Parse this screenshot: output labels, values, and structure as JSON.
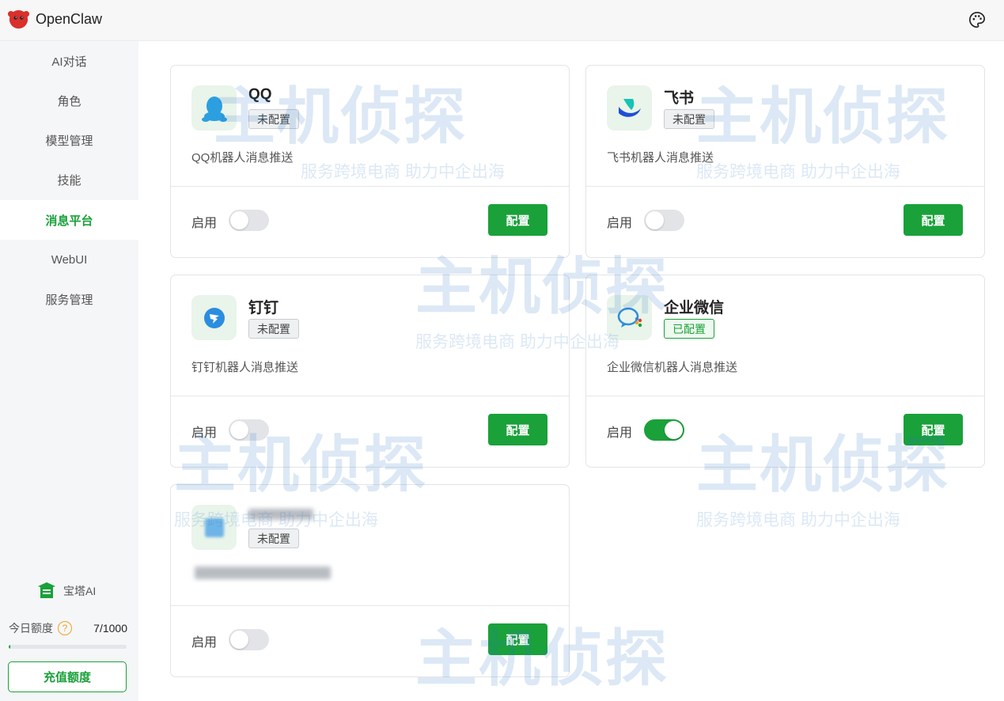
{
  "app": {
    "title": "OpenClaw"
  },
  "header": {
    "theme_icon": "palette-icon"
  },
  "sidebar": {
    "items": [
      {
        "label": "AI对话"
      },
      {
        "label": "角色"
      },
      {
        "label": "模型管理"
      },
      {
        "label": "技能"
      },
      {
        "label": "消息平台",
        "active": true
      },
      {
        "label": "WebUI"
      },
      {
        "label": "服务管理"
      }
    ],
    "brand": "宝塔AI",
    "quota_label": "今日额度",
    "quota_value": "7/1000",
    "quota_fraction": 0.007,
    "recharge_label": "充值额度"
  },
  "platforms": [
    {
      "name": "QQ",
      "status": "未配置",
      "configured": false,
      "description": "QQ机器人消息推送",
      "enable_label": "启用",
      "enabled": false,
      "config_label": "配置",
      "icon": "qq-icon"
    },
    {
      "name": "飞书",
      "status": "未配置",
      "configured": false,
      "description": "飞书机器人消息推送",
      "enable_label": "启用",
      "enabled": false,
      "config_label": "配置",
      "icon": "feishu-icon"
    },
    {
      "name": "钉钉",
      "status": "未配置",
      "configured": false,
      "description": "钉钉机器人消息推送",
      "enable_label": "启用",
      "enabled": false,
      "config_label": "配置",
      "icon": "dingtalk-icon"
    },
    {
      "name": "企业微信",
      "status": "已配置",
      "configured": true,
      "description": "企业微信机器人消息推送",
      "enable_label": "启用",
      "enabled": true,
      "config_label": "配置",
      "icon": "wecom-icon"
    },
    {
      "name": "",
      "status": "未配置",
      "configured": false,
      "description": "",
      "enable_label": "启用",
      "enabled": false,
      "config_label": "配置",
      "icon": "blurred-platform-icon"
    }
  ],
  "watermark": {
    "title": "主机侦探",
    "subtitle": "服务跨境电商 助力中企出海"
  },
  "colors": {
    "accent": "#1aa13a",
    "watermark": "#2a78c6"
  }
}
